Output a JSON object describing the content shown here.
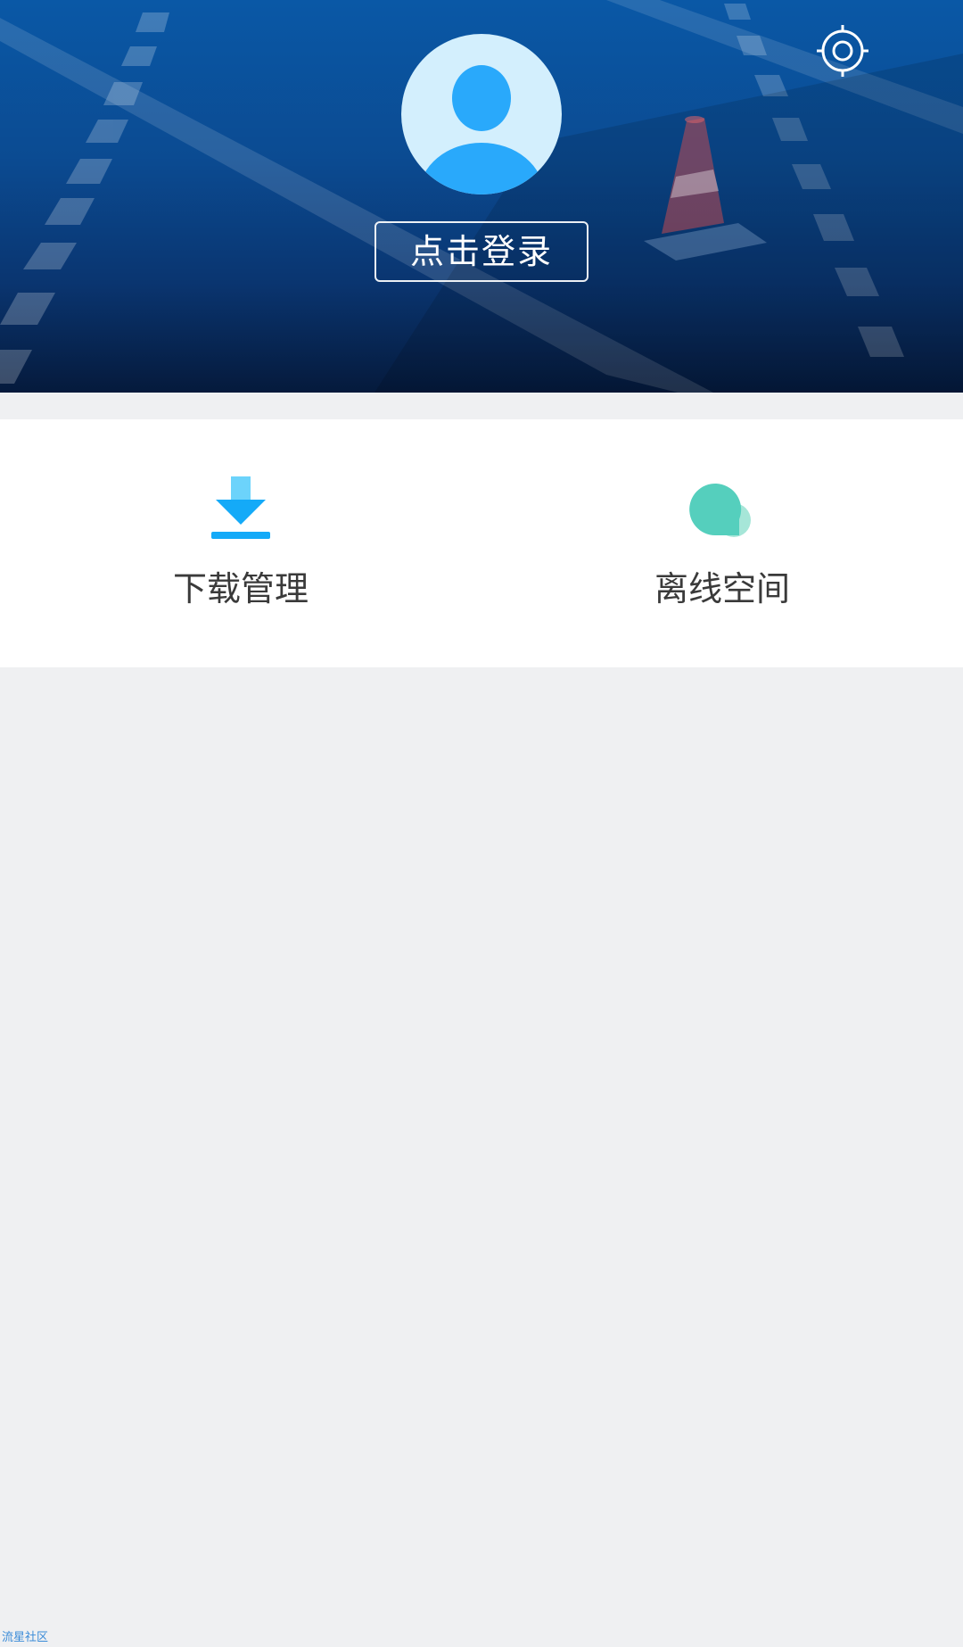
{
  "colors": {
    "header_top": "#0a58a6",
    "header_bottom": "#051a3c",
    "avatar_bg": "#d3effd",
    "avatar_figure": "#29a9fb",
    "download_icon": "#14aaf8",
    "download_icon_light": "#6cd3fb",
    "cloud_icon": "#55cfbd",
    "cloud_icon_light": "#a6e6d8",
    "page_bg": "#eff0f2",
    "panel_bg": "#ffffff",
    "label_text": "#3a3a3a"
  },
  "header": {
    "settings_icon": "settings-gear-icon",
    "avatar_icon": "user-avatar-icon",
    "login_label": "点击登录"
  },
  "menu": {
    "items": [
      {
        "label": "下载管理",
        "icon": "download-icon"
      },
      {
        "label": "离线空间",
        "icon": "cloud-icon"
      }
    ]
  },
  "watermark": "流星社区"
}
